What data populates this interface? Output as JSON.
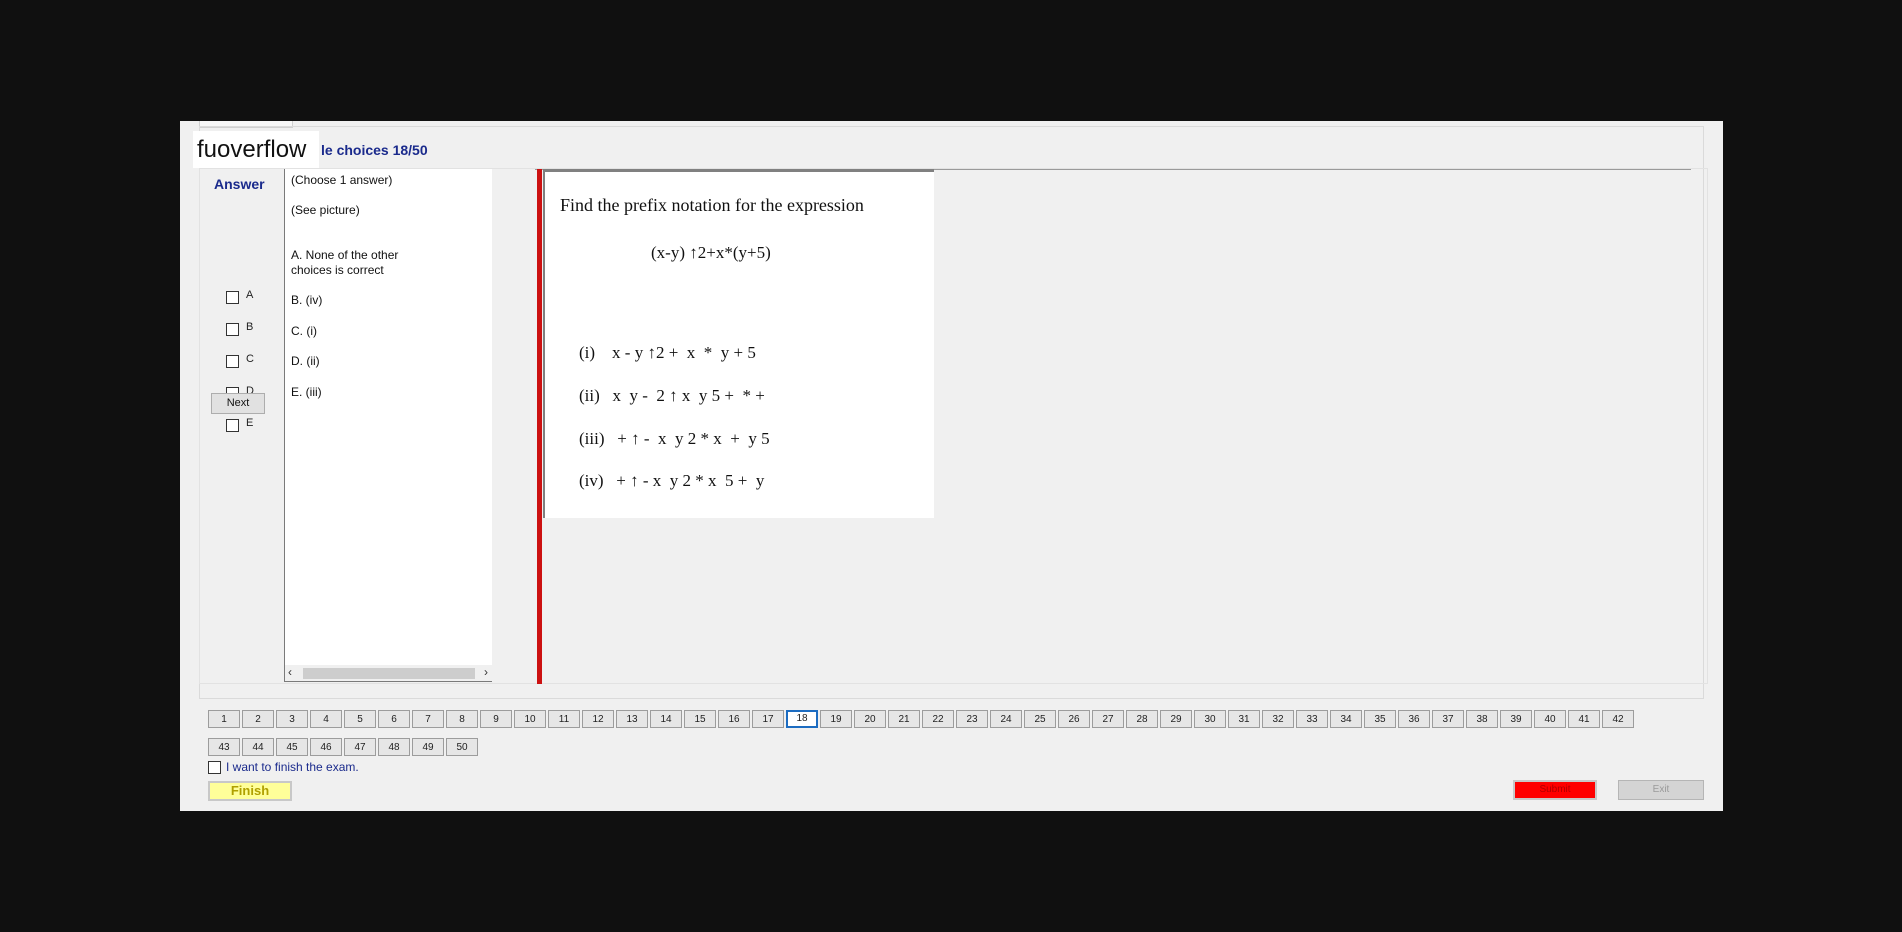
{
  "watermark": "fuoverflow",
  "header": {
    "title": "le choices 18/50"
  },
  "answer": {
    "label": "Answer",
    "options": [
      "A",
      "B",
      "C",
      "D",
      "E"
    ],
    "next_label": "Next"
  },
  "choices": {
    "instruction": "(Choose 1 answer)",
    "see_picture": "(See picture)",
    "a_line1": "A.  None of the other",
    "a_line2": "choices is correct",
    "b": "B.  (iv)",
    "c": "C.  (i)",
    "d": "D.  (ii)",
    "e": "E.  (iii)"
  },
  "picture": {
    "question": "Find the prefix notation for the expression",
    "expression": "(x-y) ↑2+x*(y+5)",
    "opt_i": "(i)    x - y ↑2 +  x  *  y + 5",
    "opt_ii": "(ii)   x  y -  2 ↑ x  y 5 +  * +",
    "opt_iii": "(iii)   + ↑ -  x  y 2 * x  +  y 5",
    "opt_iv": "(iv)   + ↑ - x  y 2 * x  5 +  y"
  },
  "navigation": {
    "row1": [
      "1",
      "2",
      "3",
      "4",
      "5",
      "6",
      "7",
      "8",
      "9",
      "10",
      "11",
      "12",
      "13",
      "14",
      "15",
      "16",
      "17",
      "18",
      "19",
      "20",
      "21",
      "22",
      "23",
      "24",
      "25",
      "26",
      "27",
      "28",
      "29",
      "30",
      "31",
      "32",
      "33",
      "34",
      "35",
      "36",
      "37",
      "38",
      "39",
      "40",
      "41",
      "42"
    ],
    "row2": [
      "43",
      "44",
      "45",
      "46",
      "47",
      "48",
      "49",
      "50"
    ],
    "current": "18"
  },
  "footer": {
    "finish_check_label": "I want to finish the exam.",
    "finish_label": "Finish",
    "submit_label": "Submit",
    "exit_label": "Exit"
  },
  "colors": {
    "accent": "#1a2a8c",
    "red": "#cc1111",
    "submit": "#ff0000",
    "finish": "#ffff99"
  }
}
